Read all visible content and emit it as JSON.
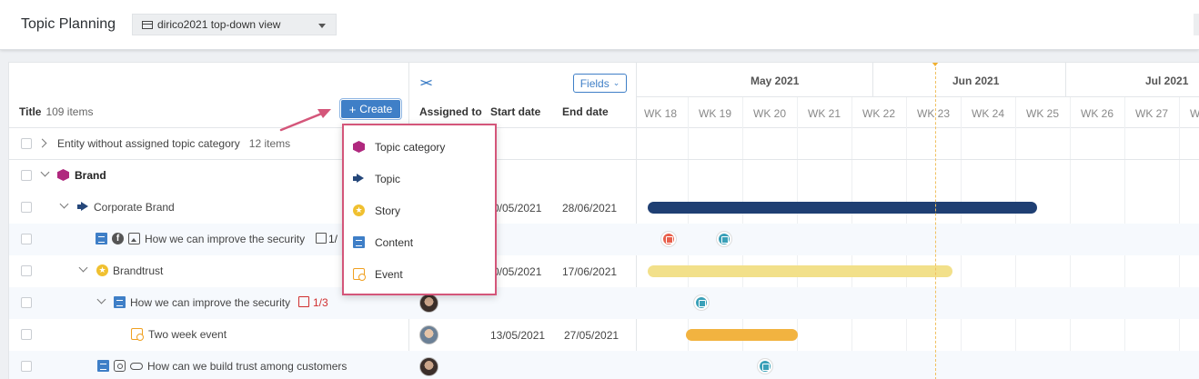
{
  "app": {
    "title": "Topic Planning",
    "view": "dirico2021 top-down view"
  },
  "table": {
    "title_label": "Title",
    "count_label": "109 items",
    "create_label": "Create",
    "fields_label": "Fields",
    "collapse_label": "><",
    "columns": {
      "assigned": "Assigned to",
      "start": "Start date",
      "end": "End date"
    }
  },
  "timeline": {
    "months": [
      "May 2021",
      "Jun 2021",
      "Jul 2021"
    ],
    "weeks": [
      "WK 18",
      "WK 19",
      "WK 20",
      "WK 21",
      "WK 22",
      "WK 23",
      "WK 24",
      "WK 25",
      "WK 26",
      "WK 27",
      "W"
    ]
  },
  "rows": [
    {
      "label": "Entity without assigned topic category",
      "count": "12 items"
    },
    {
      "label": "Brand"
    },
    {
      "label": "Corporate Brand",
      "start": "0/05/2021",
      "end": "28/06/2021"
    },
    {
      "label": "How we can improve the security",
      "tasks": "1/"
    },
    {
      "label": "Brandtrust",
      "start": "0/05/2021",
      "end": "17/06/2021"
    },
    {
      "label": "How we can improve the security",
      "tasks": "1/3"
    },
    {
      "label": "Two week event",
      "start": "13/05/2021",
      "end": "27/05/2021"
    },
    {
      "label": "How can we build trust among customers"
    }
  ],
  "menu": {
    "items": [
      {
        "label": "Topic category",
        "icon": "hexagon-icon"
      },
      {
        "label": "Topic",
        "icon": "megaphone-icon"
      },
      {
        "label": "Story",
        "icon": "star-icon"
      },
      {
        "label": "Content",
        "icon": "document-icon"
      },
      {
        "label": "Event",
        "icon": "event-icon"
      }
    ]
  },
  "colors": {
    "accent": "#3f7fc7",
    "topic_bar": "#1f3f73",
    "story_bar": "#f2e08a",
    "event_bar": "#f2b340",
    "menu_border": "#d4567a"
  }
}
